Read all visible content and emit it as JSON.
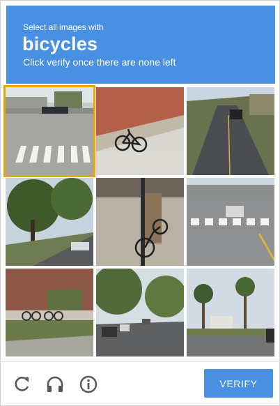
{
  "header": {
    "instruction": "Select all images with",
    "target": "bicycles",
    "sub_instruction": "Click verify once there are none left"
  },
  "tiles": [
    {
      "name": "crosswalk-parking-lot",
      "selected": true
    },
    {
      "name": "bicycle-by-brick-wall",
      "selected": false
    },
    {
      "name": "road-with-cars",
      "selected": false
    },
    {
      "name": "tree-lined-street",
      "selected": false
    },
    {
      "name": "bicycle-at-pole",
      "selected": false
    },
    {
      "name": "crosswalk-intersection",
      "selected": false
    },
    {
      "name": "bike-rack-campus",
      "selected": false
    },
    {
      "name": "residential-street",
      "selected": false
    },
    {
      "name": "palm-trees-road",
      "selected": false
    }
  ],
  "footer": {
    "reload_icon": "reload-icon",
    "audio_icon": "headphones-icon",
    "info_icon": "info-icon",
    "verify_label": "VERIFY"
  },
  "colors": {
    "accent": "#4a90e2",
    "selected_border": "#f0a500",
    "icon": "#555555"
  }
}
